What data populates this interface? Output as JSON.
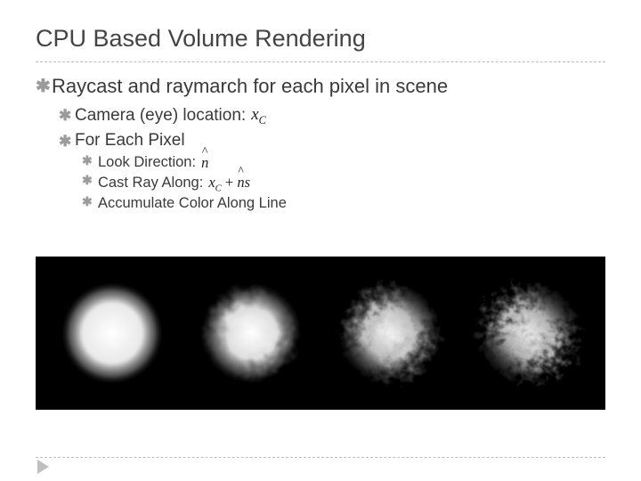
{
  "title": "CPU Based Volume Rendering",
  "bullets": {
    "l1": "Raycast and raymarch for each pixel in scene",
    "l2a": "Camera (eye) location:",
    "l2b": "For Each Pixel",
    "l3a": "Look Direction:",
    "l3b": "Cast Ray Along:",
    "l3c": "Accumulate Color Along Line"
  },
  "math": {
    "xC": "x",
    "xC_sub": "C",
    "n": "n",
    "ray_x": "x",
    "ray_x_sub": "C",
    "ray_plus": " + ",
    "ray_n": "n",
    "ray_s": "s"
  },
  "figure": {
    "description": "four volume-rendered cloud spheres on black, increasing noise detail left to right",
    "background": "#000000",
    "cloud_color": "#ffffff",
    "count": 4
  },
  "icons": {
    "bullet_glyph": "✱",
    "play": "play-triangle"
  }
}
